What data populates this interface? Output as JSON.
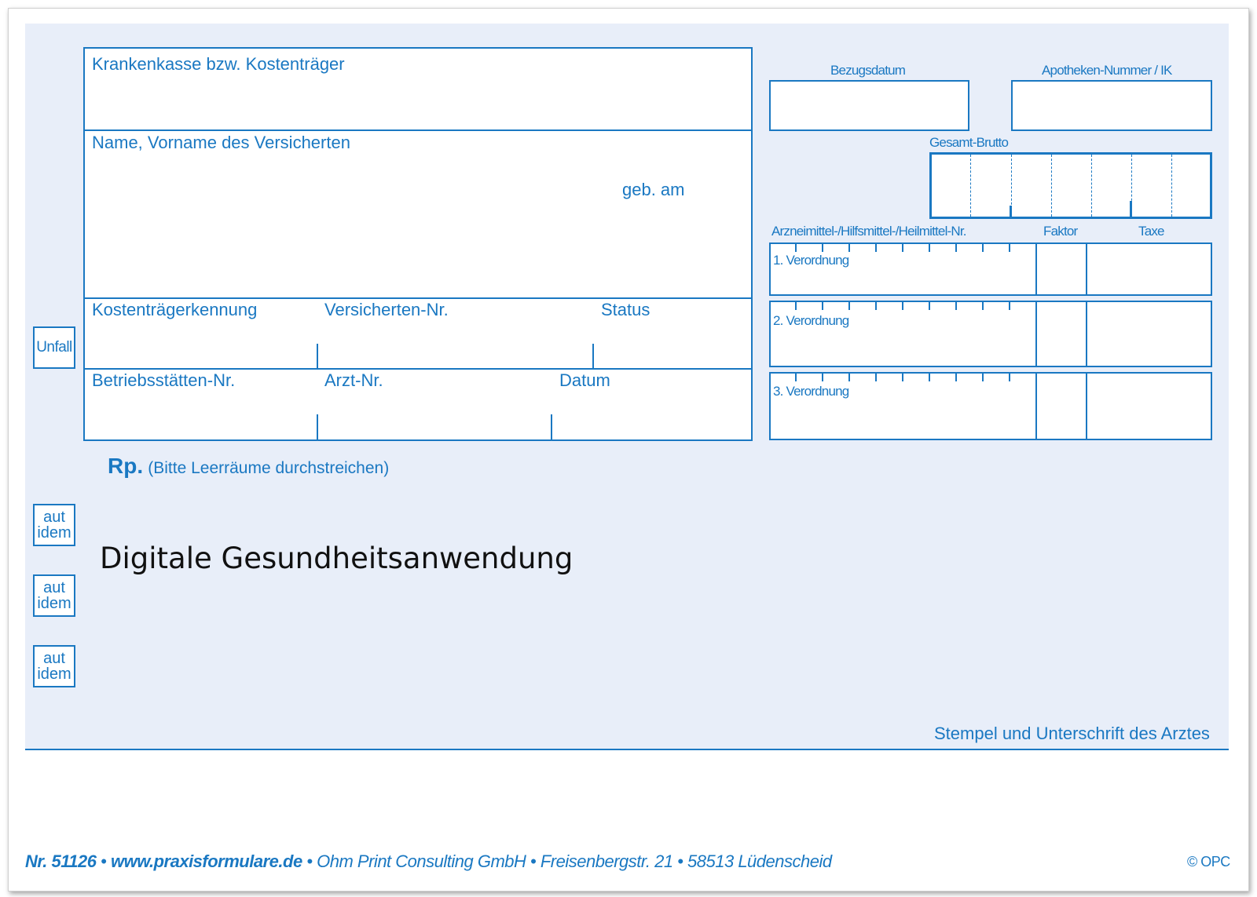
{
  "patient_block": {
    "insurer_label": "Krankenkasse bzw. Kostenträger",
    "name_label": "Name, Vorname des Versicherten",
    "birth_label": "geb. am",
    "payer_id_label": "Kostenträgerkennung",
    "insured_no_label": "Versicherten-Nr.",
    "status_label": "Status",
    "site_no_label": "Betriebsstätten-Nr.",
    "doctor_no_label": "Arzt-Nr.",
    "date_label": "Datum"
  },
  "side_boxes": {
    "accident": "Unfall",
    "aut_idem": [
      {
        "line1": "aut",
        "line2": "idem"
      },
      {
        "line1": "aut",
        "line2": "idem"
      },
      {
        "line1": "aut",
        "line2": "idem"
      }
    ]
  },
  "pharmacy_block": {
    "purchase_date_label": "Bezugsdatum",
    "pharmacy_no_label": "Apotheken-Nummer / IK",
    "gross_total_label": "Gesamt-Brutto",
    "item_no_label": "Arzneimittel-/Hilfsmittel-/Heilmittel-Nr.",
    "factor_label": "Faktor",
    "fee_label": "Taxe",
    "prescriptions": [
      "1. Verordnung",
      "2. Verordnung",
      "3. Verordnung"
    ]
  },
  "rp": {
    "symbol": "Rp.",
    "hint": "(Bitte Leerräume durchstreichen)"
  },
  "prescription_text": "Digitale Gesundheitsanwendung",
  "signature_label": "Stempel und Unterschrift des Arztes",
  "footer": {
    "form_no": "Nr. 51126",
    "website": "www.praxisformulare.de",
    "company": "Ohm Print Consulting GmbH",
    "street": "Freisenbergstr. 21",
    "city": "58513 Lüdenscheid",
    "copyright": "© OPC"
  },
  "colors": {
    "form_blue": "#1a78c2",
    "background_tint": "#e8eef9",
    "handwritten_text": "#111111"
  }
}
